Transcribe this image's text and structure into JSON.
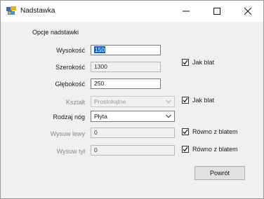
{
  "window": {
    "title": "Nadstawka"
  },
  "group": {
    "title": "Opcje nadstawki"
  },
  "fields": {
    "wysokosc": {
      "label": "Wysokość",
      "value": "150"
    },
    "szerokosc": {
      "label": "Szerokość",
      "value": "1300"
    },
    "glebokosc": {
      "label": "Głębokość",
      "value": "250"
    },
    "ksztalt": {
      "label": "Kształt",
      "value": "Prostokątne"
    },
    "rodzaj_nog": {
      "label": "Rodzaj nóg",
      "value": "Płyta"
    },
    "wysuw_lewy": {
      "label": "Wysuw lewy",
      "value": "0"
    },
    "wysuw_tyl": {
      "label": "Wysuw tył",
      "value": "0"
    }
  },
  "checkboxes": {
    "jak_blat_1": {
      "label": "Jak blat",
      "checked": true
    },
    "jak_blat_2": {
      "label": "Jak blat",
      "checked": true
    },
    "rowno_1": {
      "label": "Równo z blatem",
      "checked": true
    },
    "rowno_2": {
      "label": "Równo z blatem",
      "checked": true
    }
  },
  "buttons": {
    "back": "Powrót"
  },
  "icons": {
    "app": "app-icon",
    "minimize": "minimize-icon",
    "maximize": "maximize-icon",
    "close": "close-icon",
    "dropdown": "chevron-down-icon",
    "check": "check-icon"
  },
  "colors": {
    "window_bg": "#f0f0f0",
    "titlebar_bg": "#ffffff",
    "selection": "#0a64c8",
    "button_bg": "#e1e1e1",
    "app_icon_blue": "#2f6fc8",
    "app_icon_yellow": "#e8b400"
  }
}
